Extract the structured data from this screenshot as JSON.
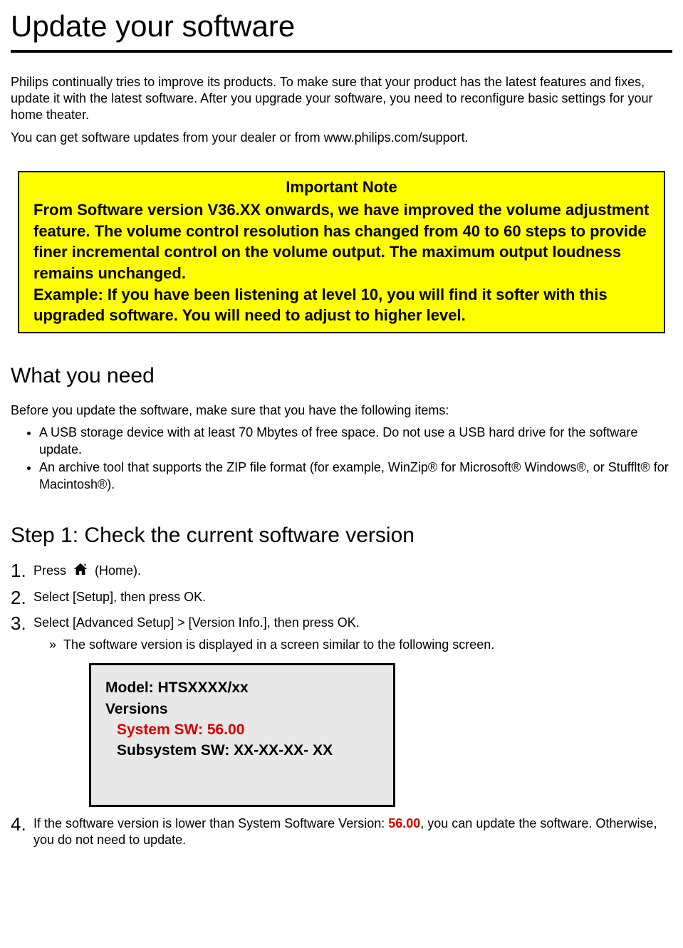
{
  "title": "Update your software",
  "intro1": "Philips continually tries to improve its products. To make sure that your product has the latest features and fixes, update it with the latest software. After you upgrade your software, you need to reconfigure basic settings for your home theater.",
  "intro2": "You can get software updates from your dealer or from www.philips.com/support.",
  "note": {
    "title": "Important Note",
    "body1": "From Software version V36.XX onwards, we have improved the volume adjustment feature. The volume control resolution has changed from 40 to 60 steps to provide finer incremental control on the volume output. The maximum output loudness remains unchanged.",
    "body2": "Example: If you have been listening at level 10, you will find it softer with this upgraded software. You will need to adjust to higher level."
  },
  "section_need": {
    "heading": "What you need",
    "intro": "Before you update the software, make sure that you have the following items:",
    "items": [
      "A USB storage device with at least 70 Mbytes of free space. Do not use a USB hard drive for the software update.",
      "An archive tool that supports the ZIP file format (for example, WinZip® for Microsoft® Windows®, or Stufflt® for Macintosh®)."
    ]
  },
  "section_step1": {
    "heading": "Step 1: Check the current software version",
    "steps": {
      "s1a": "Press ",
      "s1b": " (Home).",
      "s2": "Select [Setup], then press OK.",
      "s3": "Select [Advanced Setup] > [Version Info.], then press OK.",
      "s3sub": "The software version is displayed in a screen similar to the following screen.",
      "s4a": "If the software version is lower than System Software Version: ",
      "s4ver": "56.00",
      "s4b": ", you can update the software. Otherwise, you do not need to update."
    },
    "screen": {
      "model": "Model: HTSXXXX/xx",
      "versions_label": "Versions",
      "system_sw": "System SW: 56.00",
      "subsystem_sw": "Subsystem SW: XX-XX-XX- XX"
    }
  }
}
